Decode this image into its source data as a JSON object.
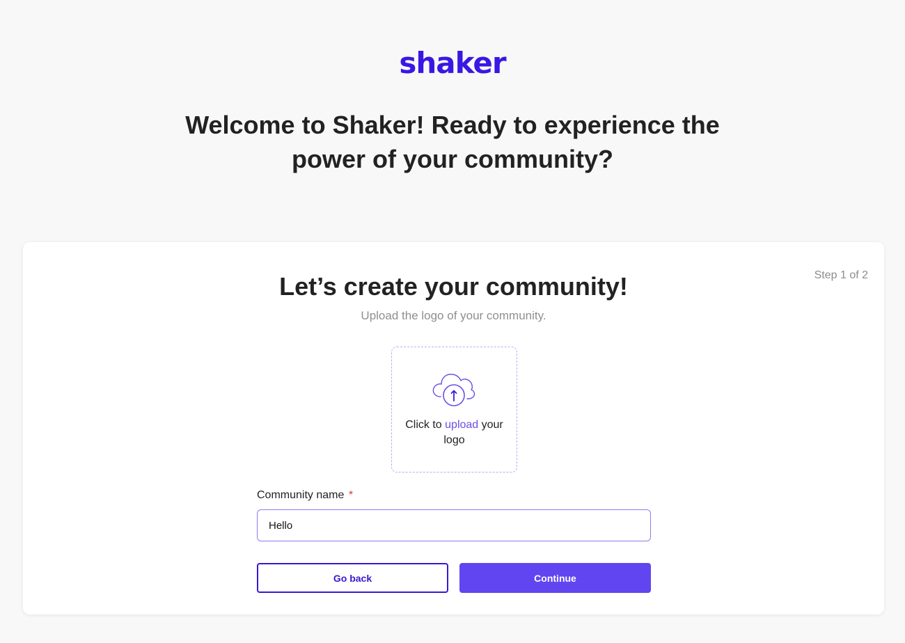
{
  "brand": {
    "logo_text": "shaker",
    "color": "#3a17e4"
  },
  "welcome": {
    "line1": "Welcome to Shaker! Ready to experience the",
    "line2": "power of your community?"
  },
  "card": {
    "step_label": "Step 1 of 2",
    "title": "Let’s create your community!",
    "subtitle": "Upload the logo of your community."
  },
  "upload": {
    "icon": "cloud-upload-icon",
    "text_before": "Click to ",
    "link_text": "upload",
    "text_after": " your logo",
    "accent_color": "#6c4ee0"
  },
  "community_name": {
    "label": "Community name",
    "required_mark": "*",
    "value": "Hello"
  },
  "actions": {
    "back_label": "Go back",
    "continue_label": "Continue",
    "continue_color": "#6145f0"
  }
}
